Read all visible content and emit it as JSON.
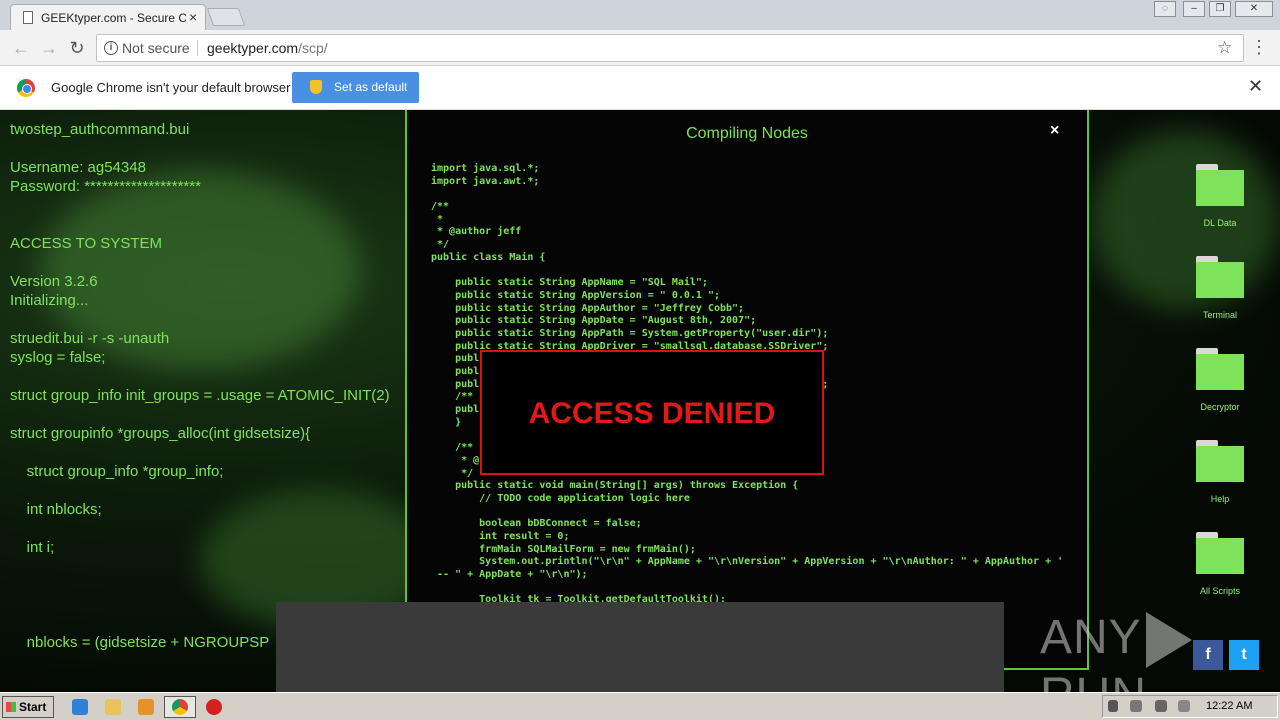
{
  "browser": {
    "tab_title": "GEEKtyper.com - Secure Co",
    "tab_close": "×",
    "not_secure": "Not secure",
    "url_host": "geektyper.com",
    "url_path": "/scp/",
    "infobar_text": "Google Chrome isn't your default browser",
    "set_default_label": "Set as default",
    "infobar_close": "✕"
  },
  "terminal": {
    "lines": [
      "twostep_authcommand.bui",
      "",
      "Username: ag54348",
      "Password: ********************",
      "",
      "",
      "ACCESS TO SYSTEM",
      "",
      "Version 3.2.6",
      "Initializing...",
      "",
      "struedit.bui -r -s -unauth",
      "syslog = false;",
      "",
      "struct group_info init_groups = .usage = ATOMIC_INIT(2)",
      "",
      "struct groupinfo *groups_alloc(int gidsetsize){",
      "",
      "    struct group_info *group_info;",
      "",
      "    int nblocks;",
      "",
      "    int i;",
      "",
      "",
      "",
      "",
      "    nblocks = (gidsetsize + NGROUPSP"
    ]
  },
  "modal": {
    "title": "Compiling Nodes",
    "close": "×",
    "code_lines": [
      "import java.sql.*;",
      "import java.awt.*;",
      "",
      "/**",
      " *",
      " * @author jeff",
      " */",
      "public class Main {",
      "",
      "    public static String AppName = \"SQL Mail\";",
      "    public static String AppVersion = \" 0.0.1 \";",
      "    public static String AppAuthor = \"Jeffrey Cobb\";",
      "    public static String AppDate = \"August 8th, 2007\";",
      "    public static String AppPath = System.getProperty(\"user.dir\");",
      "    public static String AppDriver = \"smallsql.database.SSDriver\";",
      "    publ",
      "    publ",
      "    publ                                                     ofs\";",
      "    /** ",
      "    publ",
      "    }",
      "",
      "    /**",
      "     * @",
      "     */",
      "    public static void main(String[] args) throws Exception {",
      "        // TODO code application logic here",
      "",
      "        boolean bDBConnect = false;",
      "        int result = 0;",
      "        frmMain SQLMailForm = new frmMain();",
      "        System.out.println(\"\\r\\n\" + AppName + \"\\r\\nVersion\" + AppVersion + \"\\r\\nAuthor: \" + AppAuthor + '",
      " -- \" + AppDate + \"\\r\\n\");",
      "",
      "        Toolkit tk = Toolkit.getDefaultToolkit();"
    ]
  },
  "alert": {
    "text": "ACCESS DENIED"
  },
  "desktop_icons": [
    "DL Data",
    "Terminal",
    "Decryptor",
    "Help",
    "All Scripts"
  ],
  "watermark": {
    "left": "ANY",
    "right": "RUN"
  },
  "social": {
    "facebook": "f",
    "twitter": "t"
  },
  "taskbar": {
    "start_label": "Start",
    "clock": "12:22 AM"
  },
  "colors": {
    "terminal_green": "#7ee35a",
    "alert_red": "#e41818",
    "chrome_blue": "#4a90e2"
  }
}
